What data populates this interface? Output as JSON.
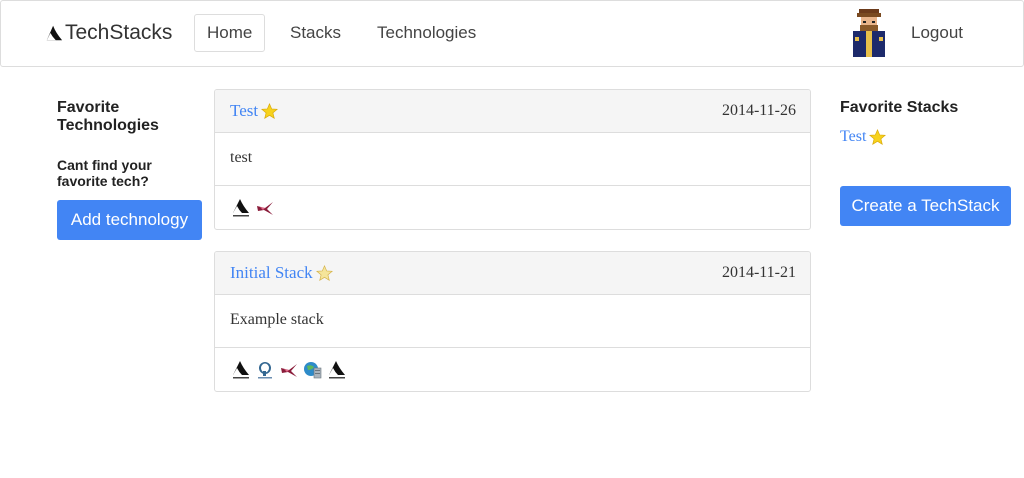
{
  "navbar": {
    "brand": "TechStacks",
    "items": [
      {
        "label": "Home"
      },
      {
        "label": "Stacks"
      },
      {
        "label": "Technologies"
      }
    ],
    "logout": "Logout"
  },
  "left": {
    "title": "Favorite Technologies",
    "subtitle": "Cant find your favorite tech?",
    "add_button": "Add technology"
  },
  "right": {
    "title": "Favorite Stacks",
    "favorites": [
      {
        "label": "Test"
      }
    ],
    "create_button": "Create a TechStack"
  },
  "stacks": [
    {
      "title": "Test",
      "date": "2014-11-26",
      "description": "test",
      "tech_icons": [
        "servicestack-logo-icon",
        "redis-bird-icon"
      ]
    },
    {
      "title": "Initial Stack",
      "date": "2014-11-21",
      "description": "Example stack",
      "tech_icons": [
        "servicestack-logo-icon",
        "postgresql-elephant-icon",
        "redis-bird-icon",
        "globe-server-icon",
        "servicestack-logo-icon"
      ]
    }
  ],
  "colors": {
    "accent": "#4285f4",
    "star": "#f7d21c",
    "border": "#dddddd",
    "card_header": "#f5f5f5"
  }
}
